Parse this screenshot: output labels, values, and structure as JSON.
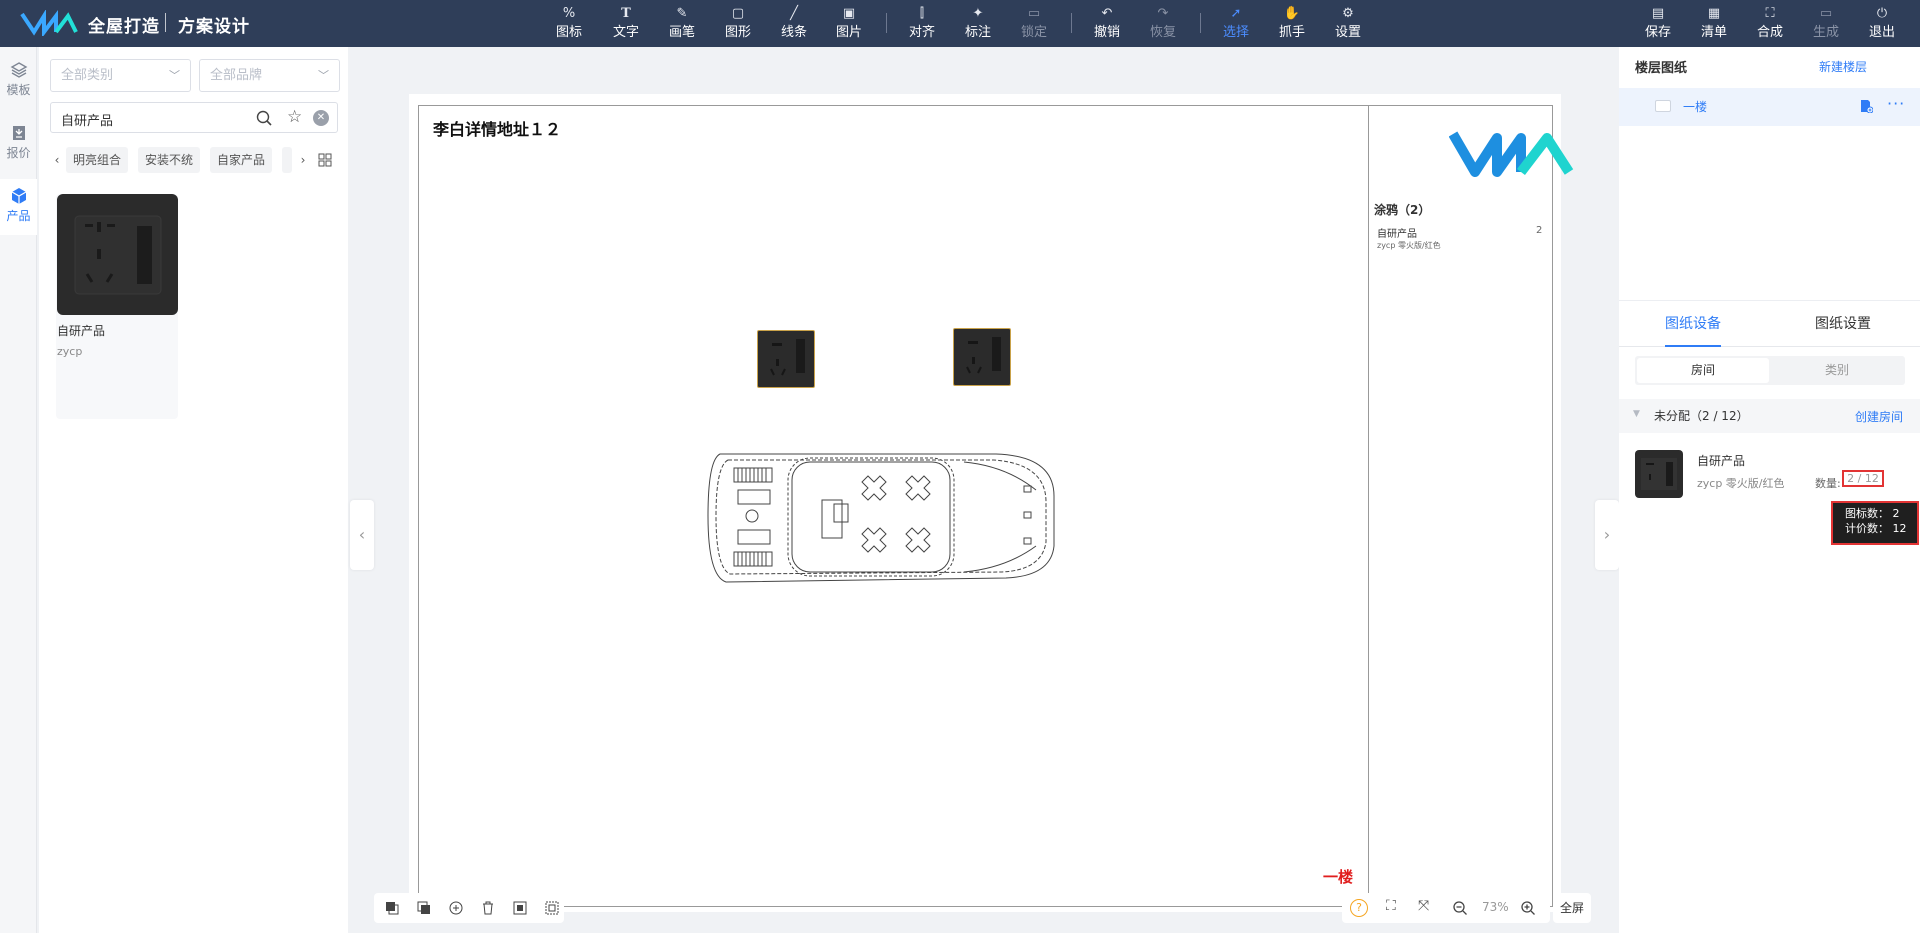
{
  "header": {
    "brand": "全屋打造",
    "subtitle": "方案设计",
    "tools": [
      {
        "icon": "icon-tool",
        "label": "图标"
      },
      {
        "icon": "text-tool",
        "label": "文字"
      },
      {
        "icon": "pen-tool",
        "label": "画笔"
      },
      {
        "icon": "shape-tool",
        "label": "图形"
      },
      {
        "icon": "line-tool",
        "label": "线条"
      },
      {
        "icon": "image-tool",
        "label": "图片"
      },
      {
        "icon": "align-tool",
        "label": "对齐"
      },
      {
        "icon": "pin-tool",
        "label": "标注"
      },
      {
        "icon": "lock-tool",
        "label": "锁定"
      },
      {
        "icon": "undo",
        "label": "撤销"
      },
      {
        "icon": "redo",
        "label": "恢复"
      },
      {
        "icon": "select-cursor",
        "label": "选择"
      },
      {
        "icon": "hand-grab",
        "label": "抓手"
      },
      {
        "icon": "settings-gear",
        "label": "设置"
      }
    ],
    "actions": [
      {
        "icon": "save",
        "label": "保存"
      },
      {
        "icon": "list",
        "label": "清单"
      },
      {
        "icon": "compose",
        "label": "合成"
      },
      {
        "icon": "generate",
        "label": "生成"
      },
      {
        "icon": "exit",
        "label": "退出"
      }
    ],
    "accent": "#2f7cf6",
    "bar_color": "#2f3e59"
  },
  "leftnav": [
    {
      "icon": "layers-icon",
      "label": "模板"
    },
    {
      "icon": "quote-icon",
      "label": "报价"
    },
    {
      "icon": "cube-icon",
      "label": "产品"
    }
  ],
  "panel": {
    "category_placeholder": "全部类别",
    "brand_placeholder": "全部品牌",
    "search_value": "自研产品",
    "chips": [
      "明亮组合",
      "安装不统",
      "自家产品"
    ],
    "product": {
      "name": "自研产品",
      "code": "zycp"
    }
  },
  "canvas": {
    "title": "李白详情地址１２",
    "floor_label": "一楼",
    "legend": {
      "heading": "涂鸦（2）",
      "item_name": "自研产品",
      "item_desc": "zycp 零火版/红色",
      "item_count": "2"
    },
    "zoom": "73%",
    "fullscreen": "全屏"
  },
  "right": {
    "header": "楼层图纸",
    "new_floor": "新建楼层",
    "floor_name": "一楼",
    "tabs": [
      "图纸设备",
      "图纸设置"
    ],
    "segments": [
      "房间",
      "类别"
    ],
    "group_label": "未分配（2 / 12）",
    "create_room": "创建房间",
    "item": {
      "name": "自研产品",
      "desc": "zycp 零火版/红色",
      "qty_label": "数量:",
      "qty": "2 / 12"
    },
    "tooltip": {
      "line1": "图标数： 2",
      "line2": "计价数： 12"
    }
  }
}
